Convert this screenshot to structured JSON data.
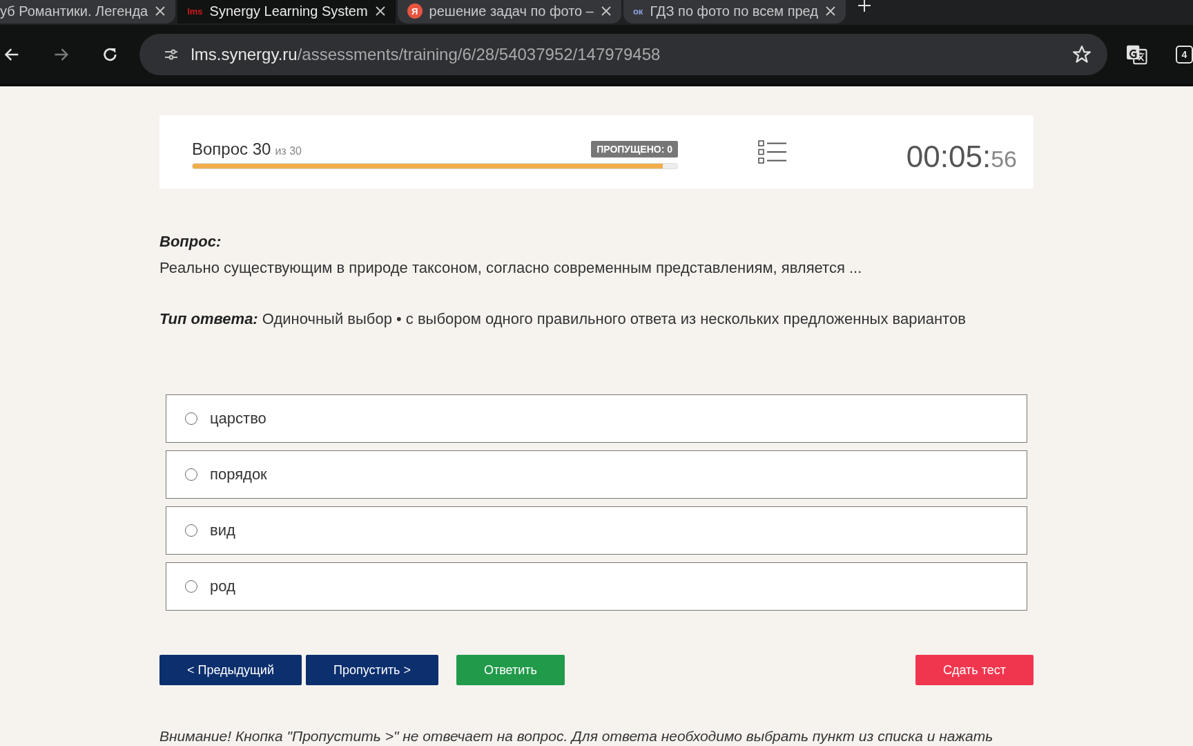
{
  "browser": {
    "tabs": [
      {
        "title": "уб Романтики. Легенда",
        "selected": false
      },
      {
        "title": "Synergy Learning System",
        "selected": true,
        "favicon": {
          "kind": "lms",
          "text": "lms"
        }
      },
      {
        "title": "решение задач по фото –",
        "selected": false,
        "favicon": {
          "kind": "round",
          "text": "Я"
        }
      },
      {
        "title": "ГДЗ по фото по всем пред",
        "selected": false,
        "favicon": {
          "kind": "plain",
          "text": "ок"
        }
      }
    ],
    "address": {
      "host": "lms.synergy.ru",
      "path": "/assessments/training/6/28/54037952/147979458"
    },
    "tab_count": "4"
  },
  "progress": {
    "question": "Вопрос 30",
    "of": "из 30",
    "skipped": "ПРОПУЩЕНО: 0",
    "level": 0.97
  },
  "timer": {
    "main": "00:05:",
    "seconds": "56"
  },
  "question": {
    "label": "Вопрос:",
    "text": "Реально существующим в природе таксоном, согласно современным представлениям, является ..."
  },
  "answer_type": {
    "label": "Тип ответа:",
    "text": "Одиночный выбор • с выбором одного правильного ответа из нескольких предложенных вариантов"
  },
  "options": [
    {
      "text": "царство",
      "selected": false
    },
    {
      "text": "порядок",
      "selected": false
    },
    {
      "text": "вид",
      "selected": false
    },
    {
      "text": "род",
      "selected": false
    }
  ],
  "buttons": [
    {
      "label": "< Предыдущий",
      "kind": "nav"
    },
    {
      "label": "Пропустить >",
      "kind": "nav"
    },
    {
      "label": "Ответить",
      "kind": "answer"
    },
    {
      "label": "Сдать тест",
      "kind": "finish"
    }
  ],
  "notice": "Внимание! Кнопка \"Пропустить >\" не отвечает на вопрос. Для ответа необходимо выбрать пункт из списка и нажать"
}
